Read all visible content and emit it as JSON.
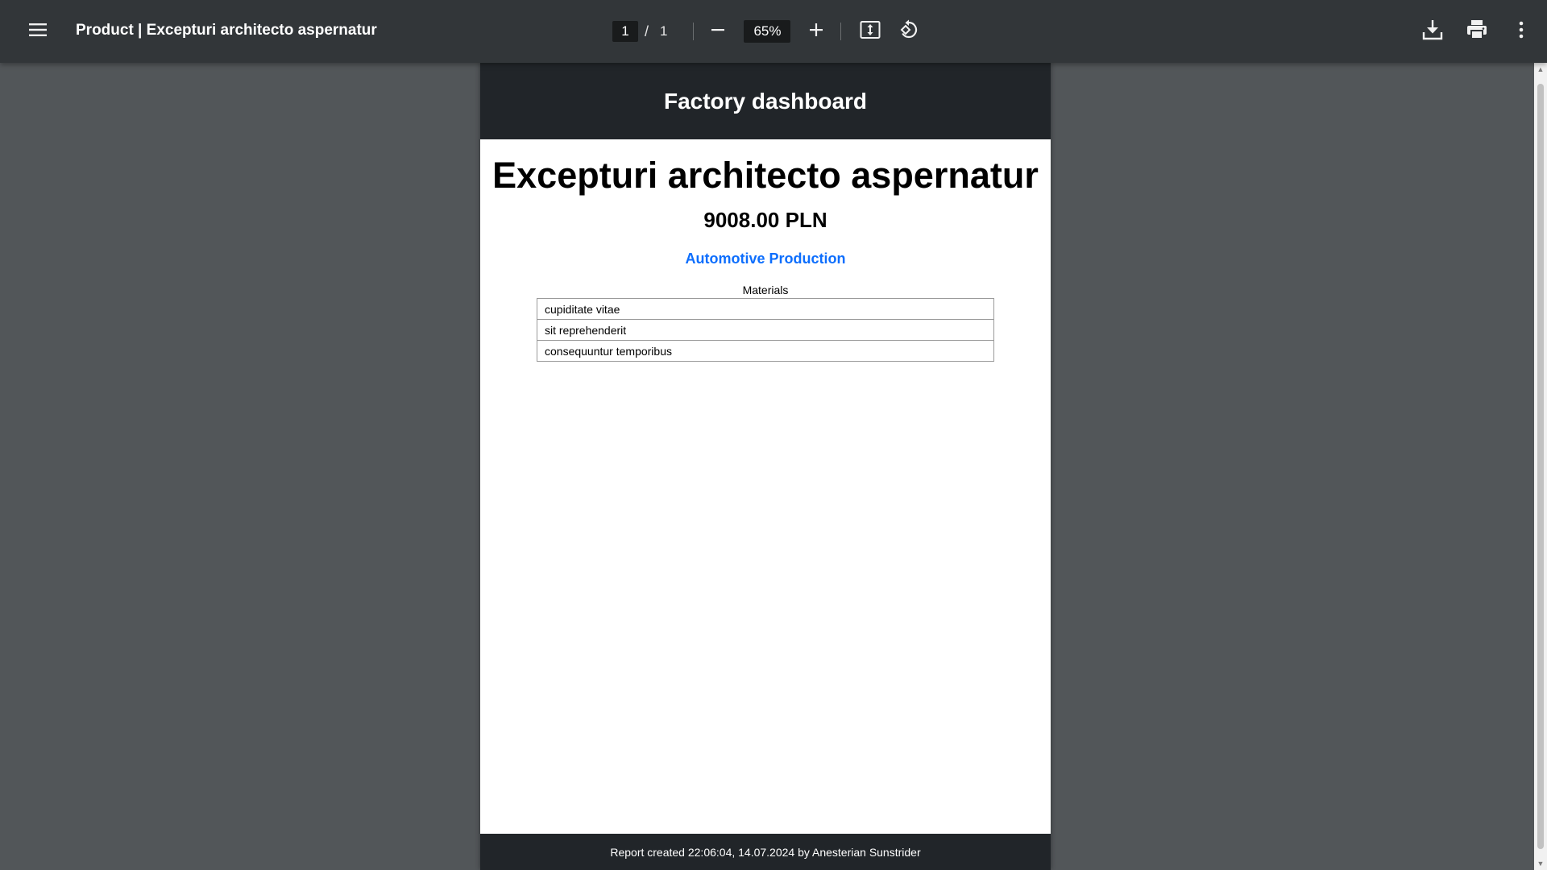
{
  "viewer": {
    "title": "Product | Excepturi architecto aspernatur",
    "page_current": "1",
    "page_separator": "/",
    "page_total": "1",
    "zoom": "65%",
    "icons": {
      "menu": "hamburger-menu-icon",
      "zoom_out": "minus-icon",
      "zoom_in": "plus-icon",
      "fit": "fit-to-page-icon",
      "rotate": "rotate-icon",
      "download": "download-icon",
      "print": "print-icon",
      "more": "more-vertical-icon"
    }
  },
  "document": {
    "header": "Factory dashboard",
    "title": "Excepturi architecto aspernatur",
    "price": "9008.00 PLN",
    "category": "Automotive Production",
    "materials_caption": "Materials",
    "materials": [
      "cupiditate vitae",
      "sit reprehenderit",
      "consequuntur temporibus"
    ],
    "footer": "Report created 22:06:04, 14.07.2024 by Anesterian Sunstrider"
  },
  "colors": {
    "toolbar_bg": "#323639",
    "viewer_bg": "#525659",
    "page_header_bg": "#212529",
    "category_link": "#0d6efd"
  }
}
